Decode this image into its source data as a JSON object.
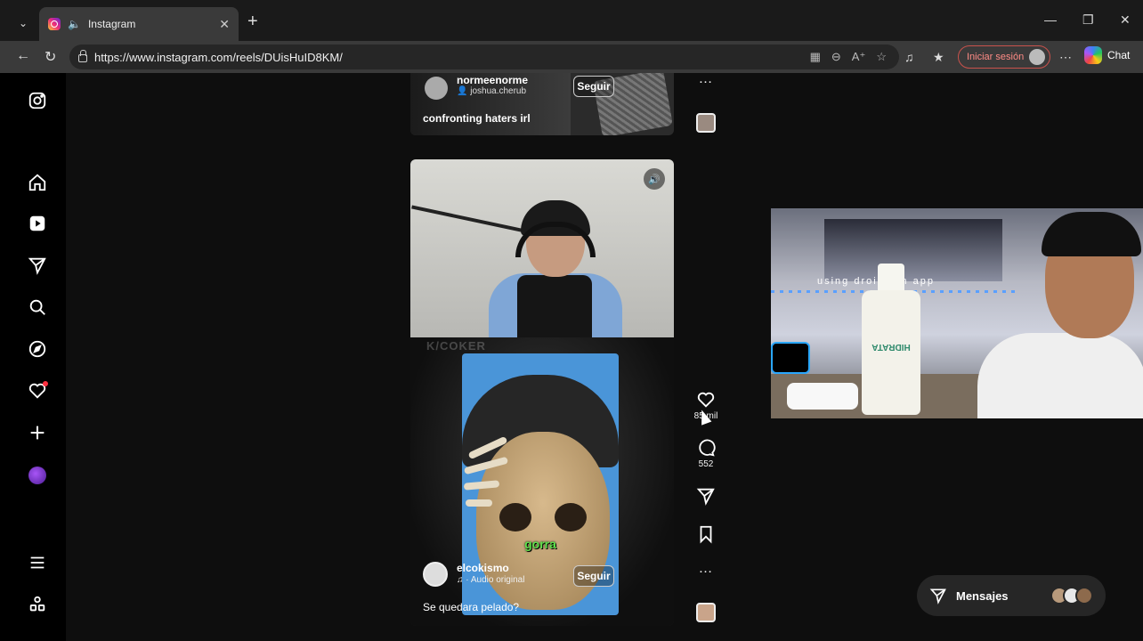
{
  "browser": {
    "tab_title": "Instagram",
    "url": "https://www.instagram.com/reels/DUisHuID8KM/",
    "signin_label": "Iniciar sesión",
    "chat_label": "Chat"
  },
  "sidebar": {
    "items": [
      {
        "name": "instagram-logo-icon"
      },
      {
        "name": "home-icon"
      },
      {
        "name": "reels-icon"
      },
      {
        "name": "messages-icon"
      },
      {
        "name": "search-icon"
      },
      {
        "name": "explore-icon"
      },
      {
        "name": "notifications-icon"
      },
      {
        "name": "create-icon"
      },
      {
        "name": "profile-avatar"
      },
      {
        "name": "more-menu-icon"
      },
      {
        "name": "also-from-meta-icon"
      }
    ]
  },
  "previous_reel": {
    "username": "normeenorme",
    "collaborator": "joshua.cherub",
    "follow_label": "Seguir",
    "caption": "confronting haters irl"
  },
  "current_reel": {
    "watermark": "K/COKER",
    "subtitle": "gorra",
    "username": "elcokismo",
    "audio": "· Audio original",
    "follow_label": "Seguir",
    "caption": "Se quedara pelado?"
  },
  "actions": {
    "likes": "85 mil",
    "comments": "552"
  },
  "webcam": {
    "overlay_text": "using droidcam app",
    "bottle_label": "HIDRATA"
  },
  "messages": {
    "label": "Mensajes"
  },
  "colors": {
    "accent_signin": "#c9524c",
    "notification_dot": "#ff3040",
    "subtitle_green": "#5ee04b"
  }
}
